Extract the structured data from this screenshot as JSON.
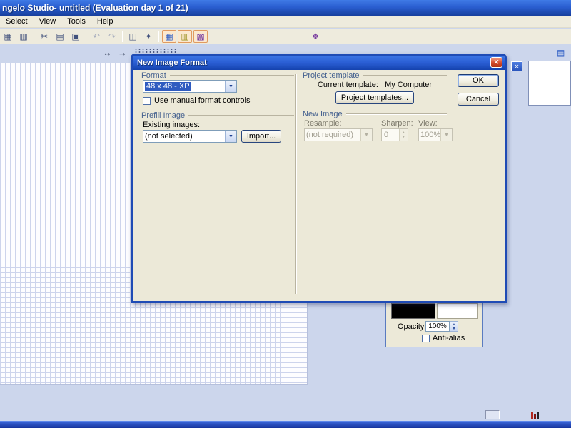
{
  "window": {
    "title": "ngelo Studio- untitled  (Evaluation day 1 of 21)",
    "menu": [
      {
        "label": "Select"
      },
      {
        "label": "View"
      },
      {
        "label": "Tools"
      },
      {
        "label": "Help"
      }
    ]
  },
  "toolbar": {
    "buttons": [
      {
        "name": "grid-icon",
        "glyph": "▦"
      },
      {
        "name": "panels-icon",
        "glyph": "▥"
      },
      {
        "name": "cut-icon",
        "glyph": "✂"
      },
      {
        "name": "copy-icon",
        "glyph": "▤"
      },
      {
        "name": "paste-icon",
        "glyph": "▣"
      },
      {
        "name": "undo-icon",
        "glyph": "↶"
      },
      {
        "name": "redo-icon",
        "glyph": "↷"
      },
      {
        "name": "capture-icon",
        "glyph": "◫"
      },
      {
        "name": "wand-icon",
        "glyph": "✦"
      },
      {
        "name": "view-grid-icon",
        "glyph": "▦"
      },
      {
        "name": "histogram-icon",
        "glyph": "▥"
      },
      {
        "name": "palette-grid-icon",
        "glyph": "▩"
      },
      {
        "name": "color-picker-icon",
        "glyph": "❖"
      }
    ],
    "row2": {
      "resize_arrow": "↔",
      "move_arrow": "→",
      "layers_glyph": "▤"
    }
  },
  "dialog": {
    "title": "New Image Format",
    "ok": "OK",
    "cancel": "Cancel",
    "format": {
      "label": "Format",
      "value": "48 x 48 - XP",
      "checkbox": "Use manual format controls"
    },
    "project": {
      "label": "Project template",
      "current_label": "Current template:",
      "current_value": "My Computer",
      "button": "Project templates..."
    },
    "prefill": {
      "label": "Prefill Image",
      "existing_label": "Existing images:",
      "value": "(not selected)",
      "import": "Import..."
    },
    "newimage": {
      "label": "New Image",
      "resample_label": "Resample:",
      "resample_value": "(not required)",
      "sharpen_label": "Sharpen:",
      "sharpen_value": "0",
      "view_label": "View:",
      "view_value": "100%"
    }
  },
  "palette": {
    "opacity_label": "Opacity:",
    "opacity_value": "100%",
    "antialias_label": "Anti-alias",
    "swatch_color": "#000000"
  },
  "icons": {
    "close": "✕",
    "combo_arrow": "▼",
    "spin_up": "▲",
    "spin_down": "▼"
  },
  "colors": {
    "titlebar_blue": "#2a5ed0",
    "dialog_bg": "#ece9d8",
    "workspace_bg": "#ccd6ec",
    "selection_blue": "#2f5bc0",
    "grid_line": "#cdd4ec",
    "close_red": "#d64a2b"
  }
}
